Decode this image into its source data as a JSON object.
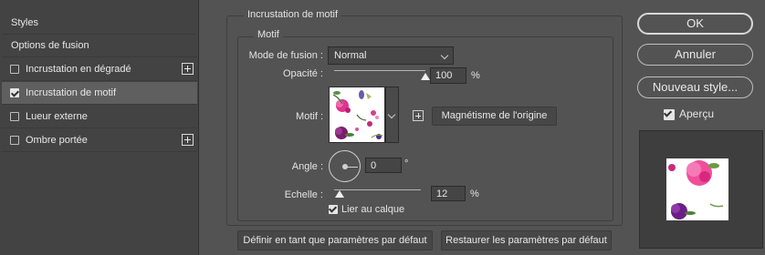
{
  "left_panel": {
    "items": [
      {
        "label": "Styles",
        "has_checkbox": false,
        "checked": false,
        "has_plus": false,
        "selected": false
      },
      {
        "label": "Options de fusion",
        "has_checkbox": false,
        "checked": false,
        "has_plus": false,
        "selected": false
      },
      {
        "label": "Incrustation en dégradé",
        "has_checkbox": true,
        "checked": false,
        "has_plus": true,
        "selected": false
      },
      {
        "label": "Incrustation de motif",
        "has_checkbox": true,
        "checked": true,
        "has_plus": false,
        "selected": true
      },
      {
        "label": "Lueur externe",
        "has_checkbox": true,
        "checked": false,
        "has_plus": false,
        "selected": false
      },
      {
        "label": "Ombre portée",
        "has_checkbox": true,
        "checked": false,
        "has_plus": true,
        "selected": false
      }
    ]
  },
  "main": {
    "section_title": "Incrustation de motif",
    "group_title": "Motif",
    "blend_mode_label": "Mode de fusion :",
    "blend_mode_value": "Normal",
    "opacity_label": "Opacité :",
    "opacity_value": "100",
    "opacity_fraction": 1.0,
    "opacity_unit": "%",
    "pattern_label": "Motif :",
    "snap_origin_label": "Magnétisme de l'origine",
    "angle_label": "Angle :",
    "angle_value": "0",
    "angle_unit": "°",
    "scale_label": "Echelle :",
    "scale_value": "12",
    "scale_unit": "%",
    "scale_fraction": 0.02,
    "link_layer_label": "Lier au calque",
    "link_layer_checked": true,
    "set_default_label": "Définir en tant que paramètres par défaut",
    "reset_default_label": "Restaurer les paramètres par défaut"
  },
  "right": {
    "ok_label": "OK",
    "cancel_label": "Annuler",
    "new_style_label": "Nouveau style...",
    "preview_label": "Aperçu",
    "preview_checked": true
  },
  "colors": {
    "panel_bg": "#535353",
    "left_panel_bg": "#434343",
    "selected_row": "#5f5f5f",
    "field_bg": "#454545"
  }
}
